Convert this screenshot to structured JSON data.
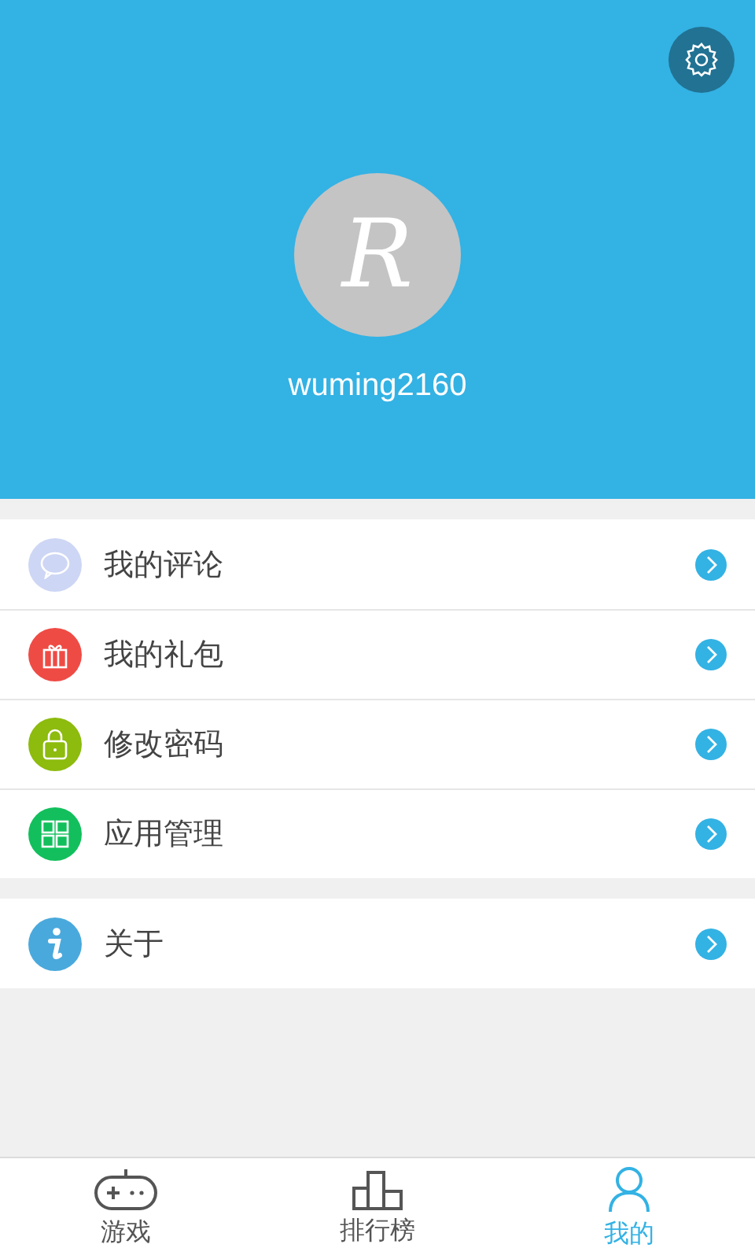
{
  "header": {
    "avatar_letter": "R",
    "username": "wuming2160"
  },
  "menu_groups": [
    {
      "items": [
        {
          "label": "我的评论",
          "kind": "comment",
          "color": "#cdd6f4"
        },
        {
          "label": "我的礼包",
          "kind": "gift",
          "color": "#ef4b45"
        },
        {
          "label": "修改密码",
          "kind": "lock",
          "color": "#8dbb0e"
        },
        {
          "label": "应用管理",
          "kind": "apps",
          "color": "#12bf5c"
        }
      ]
    },
    {
      "items": [
        {
          "label": "关于",
          "kind": "info",
          "color": "#4aa9dc"
        }
      ]
    }
  ],
  "bottom_nav": [
    {
      "label": "游戏",
      "kind": "gamepad",
      "selected": false
    },
    {
      "label": "排行榜",
      "kind": "ranking",
      "selected": false
    },
    {
      "label": "我的",
      "kind": "person",
      "selected": true
    }
  ]
}
